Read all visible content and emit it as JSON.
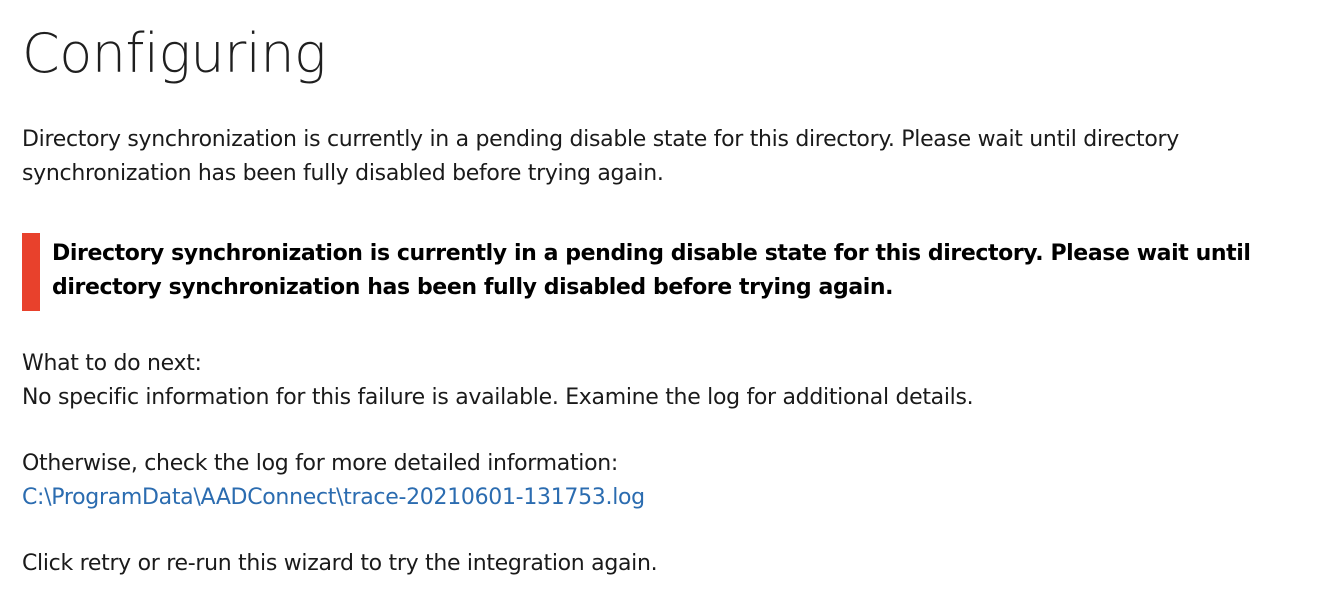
{
  "page": {
    "title": "Configuring"
  },
  "intro": {
    "line1": "Directory synchronization is currently in a pending disable state for this directory. Please wait until directory",
    "line2": "synchronization has been fully disabled before trying again."
  },
  "alert": {
    "line1": "Directory synchronization is currently in a pending disable state for this directory. Please wait until",
    "line2": "directory synchronization has been fully disabled before trying again.",
    "color": "#e8412c"
  },
  "next_steps": {
    "heading": "What to do next:",
    "body": "No specific information for this failure is available. Examine the log for additional details."
  },
  "log": {
    "label": "Otherwise, check the log for more detailed information:",
    "path": "C:\\ProgramData\\AADConnect\\trace-20210601-131753.log",
    "link_color": "#2b6cb0"
  },
  "retry": {
    "text": "Click retry or re-run this wizard to try the integration again."
  }
}
